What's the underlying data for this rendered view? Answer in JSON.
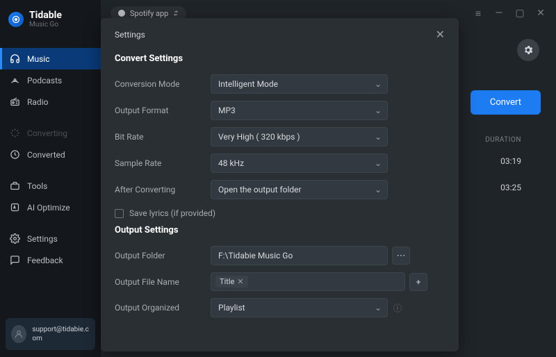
{
  "brand": {
    "title": "Tidable",
    "subtitle": "Music Go"
  },
  "sidebar": {
    "items": [
      {
        "label": "Music",
        "icon": "headphones"
      },
      {
        "label": "Podcasts",
        "icon": "podcast"
      },
      {
        "label": "Radio",
        "icon": "radio"
      },
      {
        "label": "Converting",
        "icon": "spinner",
        "dim": true
      },
      {
        "label": "Converted",
        "icon": "clock"
      },
      {
        "label": "Tools",
        "icon": "toolbox"
      },
      {
        "label": "AI Optimize",
        "icon": "ai"
      },
      {
        "label": "Settings",
        "icon": "gear"
      },
      {
        "label": "Feedback",
        "icon": "chat"
      }
    ],
    "user_email": "support@tidabie.com"
  },
  "topbar": {
    "spotify_label": "Spotify app"
  },
  "convert_button_label": "Convert",
  "tracklist": {
    "header_duration": "DURATION",
    "rows": [
      {
        "duration": "03:19"
      },
      {
        "duration": "03:25"
      }
    ]
  },
  "modal": {
    "title": "Settings",
    "section_convert": "Convert Settings",
    "section_output": "Output Settings",
    "rows": {
      "conversion_mode": {
        "label": "Conversion Mode",
        "value": "Intelligent Mode"
      },
      "output_format": {
        "label": "Output Format",
        "value": "MP3"
      },
      "bit_rate": {
        "label": "Bit Rate",
        "value": "Very High ( 320 kbps )"
      },
      "sample_rate": {
        "label": "Sample Rate",
        "value": "48 kHz"
      },
      "after_converting": {
        "label": "After Converting",
        "value": "Open the output folder"
      },
      "save_lyrics": {
        "label": "Save lyrics (if provided)"
      },
      "output_folder": {
        "label": "Output Folder",
        "value": "F:\\Tidabie Music Go"
      },
      "output_filename": {
        "label": "Output File Name",
        "tag": "Title"
      },
      "output_organized": {
        "label": "Output Organized",
        "value": "Playlist"
      }
    }
  }
}
